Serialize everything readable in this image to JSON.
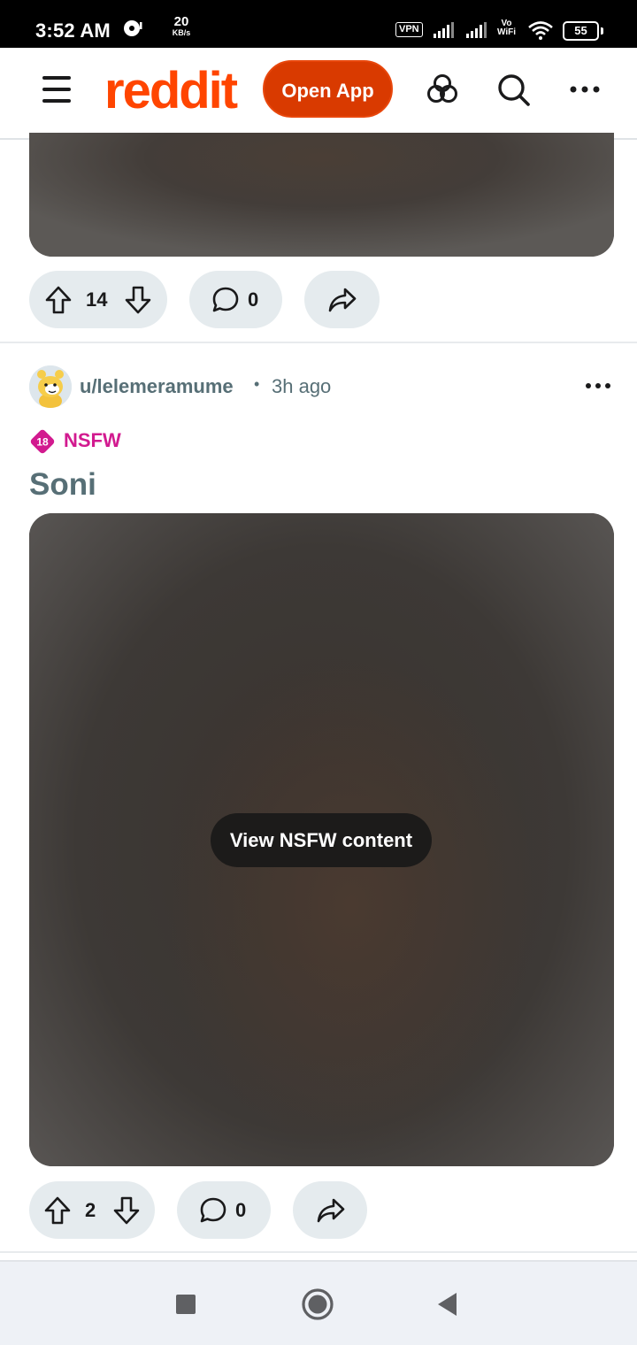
{
  "status_bar": {
    "time": "3:52 AM",
    "net_speed_value": "20",
    "net_speed_unit": "KB/s",
    "vpn": "VPN",
    "vowifi_top": "Vo",
    "vowifi_bottom": "WiFi",
    "battery": "55",
    "icons": [
      "media-icon",
      "signal-icon",
      "signal-icon",
      "wifi-icon",
      "battery-icon"
    ]
  },
  "header": {
    "logo": "reddit",
    "open_app_label": "Open App",
    "icons": [
      "menu-icon",
      "popular-icon",
      "search-icon",
      "more-icon"
    ],
    "brand_color": "#ff4500",
    "button_color": "#d93a00"
  },
  "previous_post": {
    "upvotes": "14",
    "comments": "0"
  },
  "post": {
    "author": "u/lelemeramume",
    "separator": "•",
    "time": "3h ago",
    "nsfw_badge": "18",
    "nsfw_label": "NSFW",
    "nsfw_color": "#d21a8f",
    "title": "Soni",
    "view_nsfw_label": "View NSFW content",
    "upvotes": "2",
    "comments": "0"
  },
  "nav_bar": {
    "buttons": [
      "recents-button",
      "home-button",
      "back-button"
    ]
  }
}
